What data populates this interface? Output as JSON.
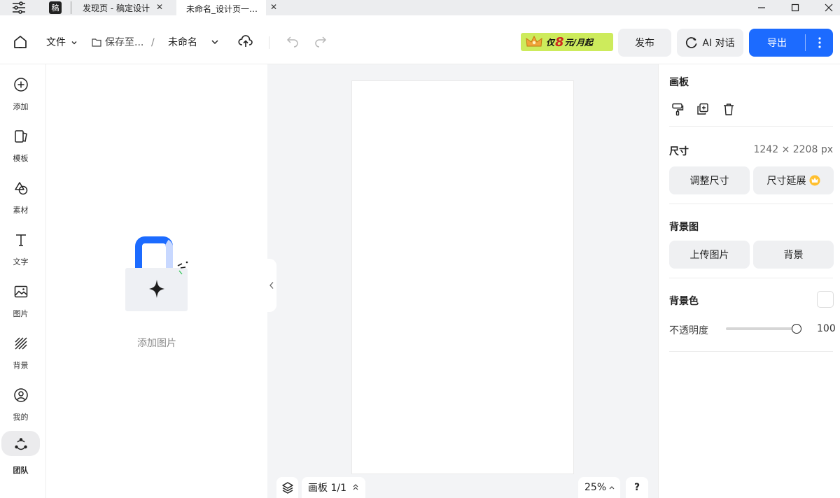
{
  "tabs": [
    {
      "logo": "稿",
      "title": "发现页 - 稿定设计"
    },
    {
      "title": "未命名_设计页一…"
    }
  ],
  "toolbar": {
    "file_label": "文件",
    "save_to_label": "保存至...",
    "path_sep": "/",
    "doc_name": "未命名",
    "promo_prefix": "仅",
    "promo_number": "8",
    "promo_suffix": "元/月起",
    "publish_label": "发布",
    "ai_chat_label": "AI 对话",
    "export_label": "导出"
  },
  "rail": [
    {
      "label": "添加",
      "icon": "plus-circle-icon"
    },
    {
      "label": "模板",
      "icon": "template-icon"
    },
    {
      "label": "素材",
      "icon": "shapes-icon"
    },
    {
      "label": "文字",
      "icon": "text-icon"
    },
    {
      "label": "图片",
      "icon": "image-icon"
    },
    {
      "label": "背景",
      "icon": "background-icon"
    },
    {
      "label": "我的",
      "icon": "user-icon"
    },
    {
      "label": "团队",
      "icon": "team-icon",
      "active": true
    }
  ],
  "panel": {
    "add_image_label": "添加图片"
  },
  "canvas": {
    "page_label": "画板 1/1",
    "zoom": "25%",
    "help": "?"
  },
  "props": {
    "artboard_title": "画板",
    "size_title": "尺寸",
    "size_value": "1242 × 2208 px",
    "resize_label": "调整尺寸",
    "extend_label": "尺寸延展",
    "bg_image_title": "背景图",
    "upload_label": "上传图片",
    "bg_label": "背景",
    "bg_color_title": "背景色",
    "opacity_label": "不透明度",
    "opacity_value": "100",
    "opacity_fraction": 1.0
  },
  "colors": {
    "accent": "#1c6bff",
    "promo_bg": "#cdeb5c",
    "canvas_bg": "#f3f4f6"
  }
}
